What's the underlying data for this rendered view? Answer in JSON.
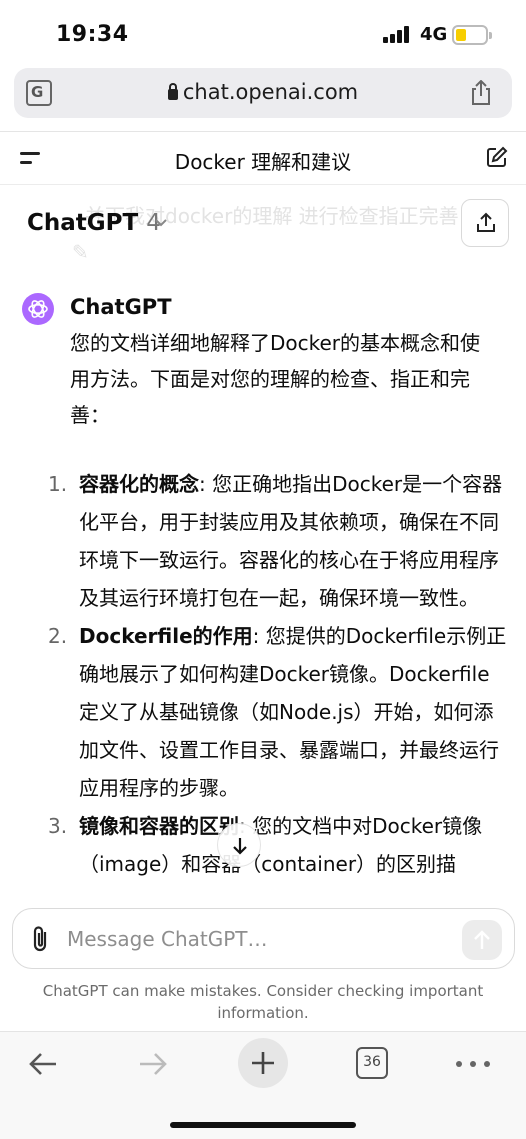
{
  "status_bar": {
    "time": "19:34",
    "network": "4G"
  },
  "browser": {
    "url": "chat.openai.com",
    "tab_count": "36"
  },
  "conversation": {
    "title": "Docker 理解和建议"
  },
  "model": {
    "name": "ChatGPT",
    "version": "4"
  },
  "ghost_prompt": "并下我对docker的理解 进行检查指正完善",
  "message": {
    "sender": "ChatGPT",
    "intro": "您的文档详细地解释了Docker的基本概念和使用方法。下面是对您的理解的检查、指正和完善：",
    "items": [
      {
        "num": "1.",
        "title": "容器化的概念",
        "text": ": 您正确地指出Docker是一个容器化平台，用于封装应用及其依赖项，确保在不同环境下一致运行。容器化的核心在于将应用程序及其运行环境打包在一起，确保环境一致性。"
      },
      {
        "num": "2.",
        "title": "Dockerfile的作用",
        "text": ": 您提供的Dockerfile示例正确地展示了如何构建Docker镜像。Dockerfile定义了从基础镜像（如Node.js）开始，如何添加文件、设置工作目录、暴露端口，并最终运行应用程序的步骤。"
      },
      {
        "num": "3.",
        "title": "镜像和容器的区别",
        "text": ": 您的文档中对Docker镜像（image）和容器（container）的区别描"
      }
    ]
  },
  "composer": {
    "placeholder": "Message ChatGPT…",
    "disclaimer": "ChatGPT can make mistakes. Consider checking important information."
  }
}
